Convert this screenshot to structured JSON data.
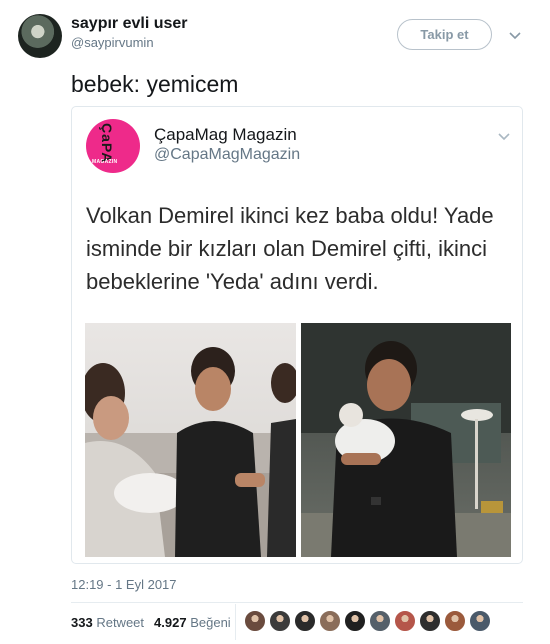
{
  "tweet": {
    "author_name": "saypır evli user",
    "author_handle": "@saypirvumin",
    "follow_label": "Takip et",
    "text": "bebek: yemicem",
    "timestamp": "12:19 - 1 Eyl 2017",
    "retweet_count": "333",
    "retweet_label": "Retweet",
    "like_count": "4.927",
    "like_label": "Beğeni"
  },
  "quoted": {
    "author_name": "ÇapaMag Magazin",
    "author_handle": "@CapaMagMagazin",
    "text": "Volkan Demirel ikinci kez baba oldu! Yade isminde bir kızları olan Demirel çifti, ikinci bebeklerine 'Yeda' adını verdi.",
    "logo_text": "ÇaPA",
    "logo_subtext": "MAGAZIN"
  },
  "likers": [
    "#6a4b3e",
    "#3b3b3b",
    "#2a2a2a",
    "#8a6d5a",
    "#202020",
    "#55606a",
    "#b5564a",
    "#2e2e2e",
    "#9b5a3c",
    "#4a5a6a"
  ],
  "colors": {
    "pink": "#ee2a8a",
    "muted": "#657786",
    "border": "#e1e8ed"
  }
}
